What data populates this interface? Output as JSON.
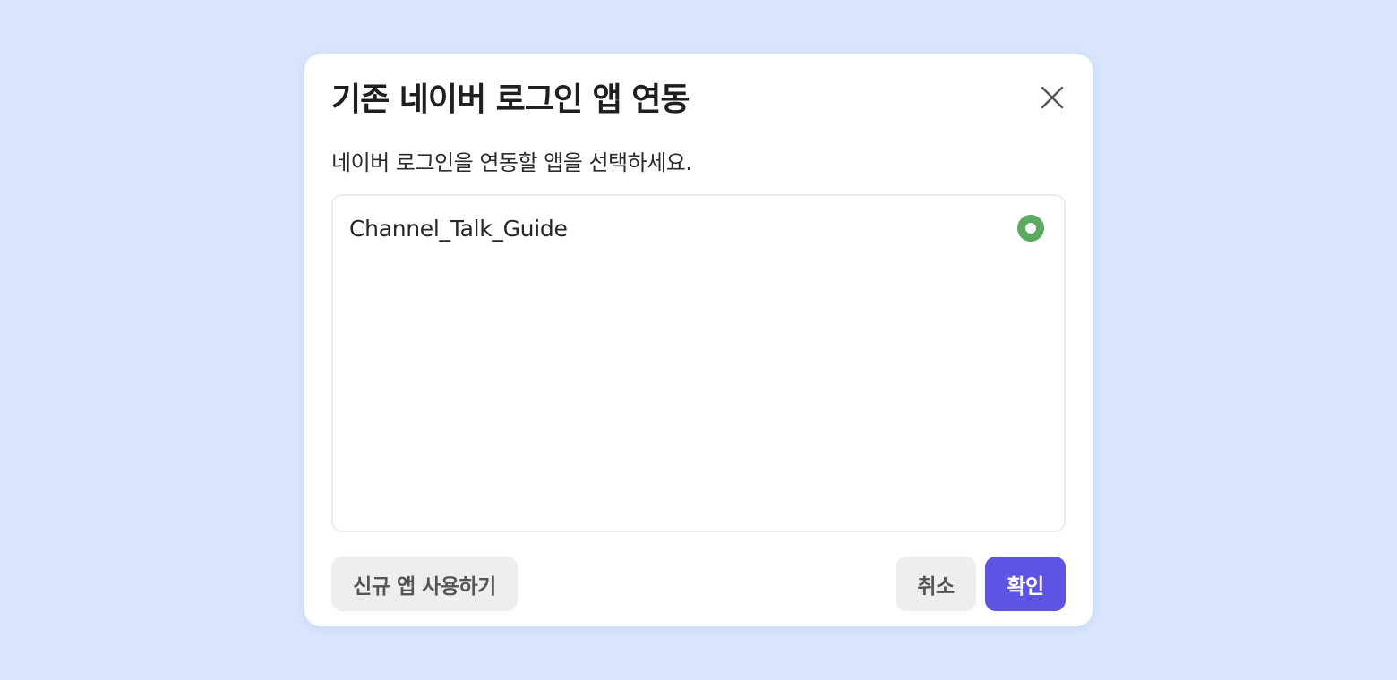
{
  "dialog": {
    "title": "기존 네이버 로그인 앱 연동",
    "description": "네이버 로그인을 연동할 앱을 선택하세요.",
    "close_icon": "close-icon"
  },
  "apps": [
    {
      "name": "Channel_Talk_Guide",
      "selected": true
    }
  ],
  "buttons": {
    "new_app": "신규 앱 사용하기",
    "cancel": "취소",
    "confirm": "확인"
  },
  "colors": {
    "background": "#d8e5fd",
    "accent": "#5e54e4",
    "radio_selected": "#5aaa5f"
  }
}
